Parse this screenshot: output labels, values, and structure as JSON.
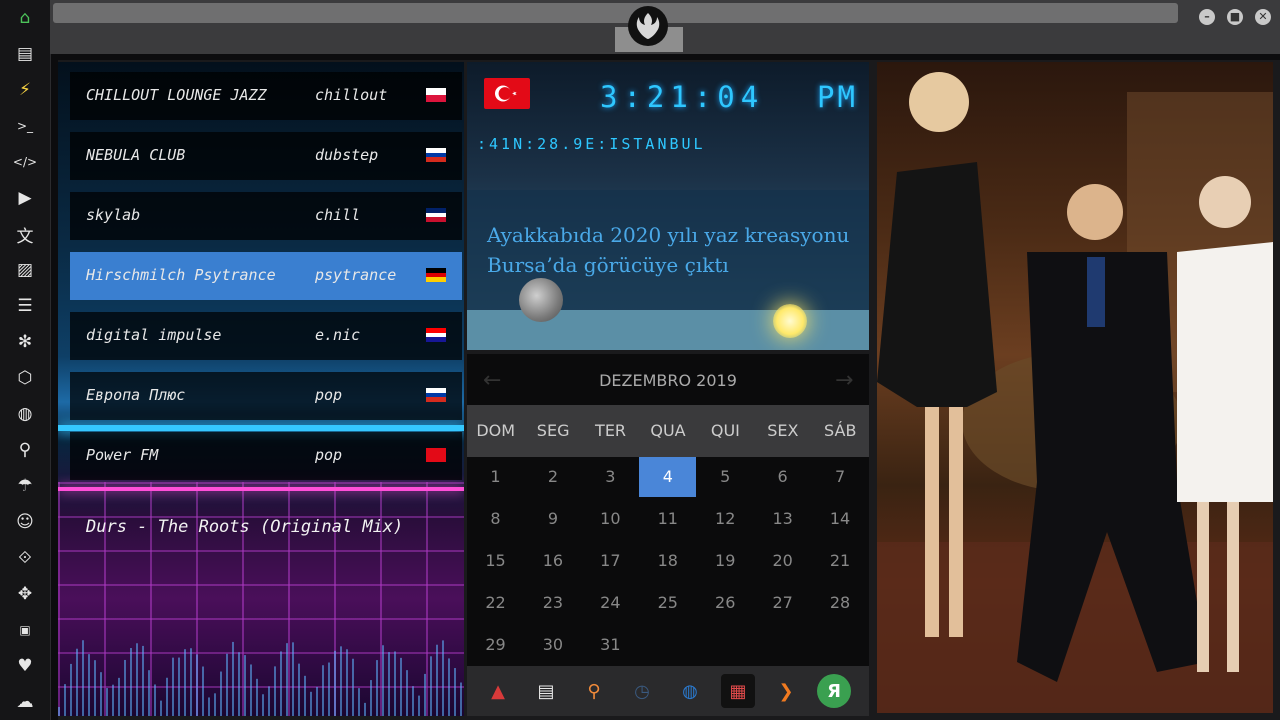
{
  "window": {
    "minimize_label": "–",
    "maximize_label": "■",
    "close_label": "✕"
  },
  "sidebar": {
    "icons": [
      "home-icon",
      "document-icon",
      "lightning-icon",
      "terminal-icon",
      "code-icon",
      "play-icon",
      "translate-icon",
      "image-icon",
      "news-icon",
      "settings-snowflake-icon",
      "hexagon-icon",
      "globe-icon",
      "search-icon",
      "umbrella-icon",
      "contacts-icon",
      "link-icon",
      "expand-icon",
      "youtube-icon",
      "heart-icon",
      "cloud-icon"
    ]
  },
  "radio": {
    "stations": [
      {
        "name": "CHILLOUT LOUNGE JAZZ",
        "genre": "chillout",
        "flag": [
          "#ffffff",
          "#dc143c"
        ]
      },
      {
        "name": "NEBULA CLUB",
        "genre": "dubstep",
        "flag": [
          "#ffffff",
          "#0039a6",
          "#d52b1e"
        ]
      },
      {
        "name": "skylab",
        "genre": "chill",
        "flag": [
          "#012169",
          "#ffffff",
          "#c8102e"
        ]
      },
      {
        "name": "Hirschmilch Psytrance",
        "genre": "psytrance",
        "flag": [
          "#000000",
          "#dd0000",
          "#ffce00"
        ]
      },
      {
        "name": "digital impulse",
        "genre": "e.nic",
        "flag": [
          "#ff0000",
          "#ffffff",
          "#171796"
        ]
      },
      {
        "name": "Европа Плюс",
        "genre": "pop",
        "flag": [
          "#ffffff",
          "#0039a6",
          "#d52b1e"
        ]
      },
      {
        "name": "Power FM",
        "genre": "pop",
        "flag": [
          "#e30a17"
        ]
      }
    ],
    "now_playing": "Durs - The Roots (Original Mix)"
  },
  "clock": {
    "time": "3:21:04",
    "ampm": "PM",
    "location": ":41N:28.9E:ISTANBUL",
    "news": "Ayakkabıda 2020 yılı yaz kreasyonu Bursa’da görücüye çıktı"
  },
  "calendar": {
    "month": "DEZEMBRO 2019",
    "prev": "←",
    "next": "→",
    "weekdays": [
      "DOM",
      "SEG",
      "TER",
      "QUA",
      "QUI",
      "SEX",
      "SÁB"
    ],
    "today": 4,
    "days": [
      "1",
      "2",
      "3",
      "4",
      "5",
      "6",
      "7",
      "8",
      "9",
      "10",
      "11",
      "12",
      "13",
      "14",
      "15",
      "16",
      "17",
      "18",
      "19",
      "20",
      "21",
      "22",
      "23",
      "24",
      "25",
      "26",
      "27",
      "28",
      "29",
      "30",
      "31"
    ]
  },
  "dock": {
    "items": [
      {
        "name": "dock-red-app-icon",
        "color": "#d83a3a"
      },
      {
        "name": "dock-newspaper-icon",
        "color": "#e8e8e8"
      },
      {
        "name": "dock-search-icon",
        "color": "#f08a3a"
      },
      {
        "name": "dock-clock-icon",
        "color": "#3a5a80"
      },
      {
        "name": "dock-globe-icon",
        "color": "#2a7ad0"
      },
      {
        "name": "dock-calendar-icon",
        "color": "#e04a4a"
      },
      {
        "name": "dock-forward-icon",
        "color": "#f07a20"
      },
      {
        "name": "dock-yandex-icon",
        "color": "#3aa050"
      }
    ],
    "yandex_glyph": "Я"
  },
  "colors": {
    "accent": "#4a86d8",
    "clock_digits": "#2ec7ff",
    "news_text": "#4aa9e8"
  }
}
